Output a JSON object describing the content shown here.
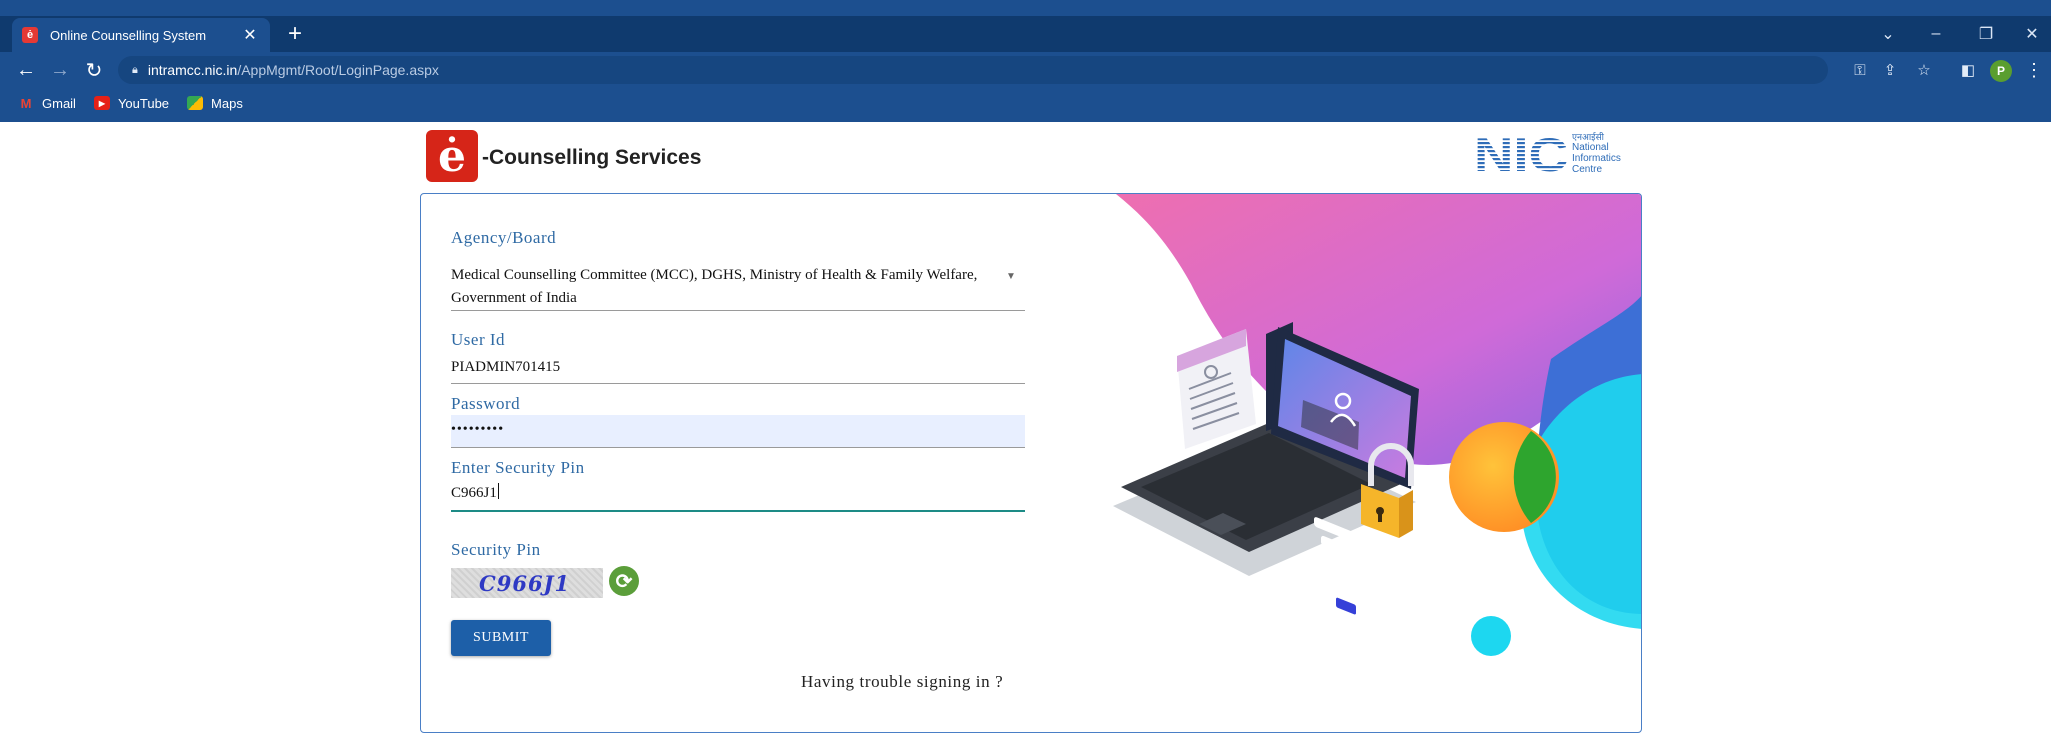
{
  "browser": {
    "tab_title": "Online Counselling System",
    "tab_favicon": "ė",
    "new_tab_symbol": "+",
    "url_domain": "intramcc.nic.in",
    "url_path": "/AppMgmt/Root/LoginPage.aspx",
    "profile_initial": "P",
    "bookmarks": [
      {
        "label": "Gmail",
        "icon": "gmail-icon"
      },
      {
        "label": "YouTube",
        "icon": "youtube-icon"
      },
      {
        "label": "Maps",
        "icon": "maps-icon"
      }
    ]
  },
  "header": {
    "logo_letter": "ė",
    "brand_title": "-Counselling Services",
    "nic_logo_text": "NIC",
    "nic_lines": [
      "एनआईसी",
      "National",
      "Informatics",
      "Centre"
    ]
  },
  "form": {
    "agency_label": "Agency/Board",
    "agency_value": "Medical Counselling Committee (MCC), DGHS, Ministry of Health & Family Welfare, Government of India",
    "userid_label": "User Id",
    "userid_value": "PIADMIN701415",
    "password_label": "Password",
    "password_value": "•••••••••",
    "pin_label": "Enter Security Pin",
    "pin_value": "C966J1",
    "security_pin_label": "Security Pin",
    "captcha_text": "C966J1",
    "submit_label": "SUBMIT",
    "trouble_text": "Having trouble signing in ?"
  },
  "colors": {
    "chrome": "#1c4f8f",
    "tabstrip": "#0f3a6e",
    "accent": "#2f6aa4",
    "submit": "#1d5fa8"
  }
}
